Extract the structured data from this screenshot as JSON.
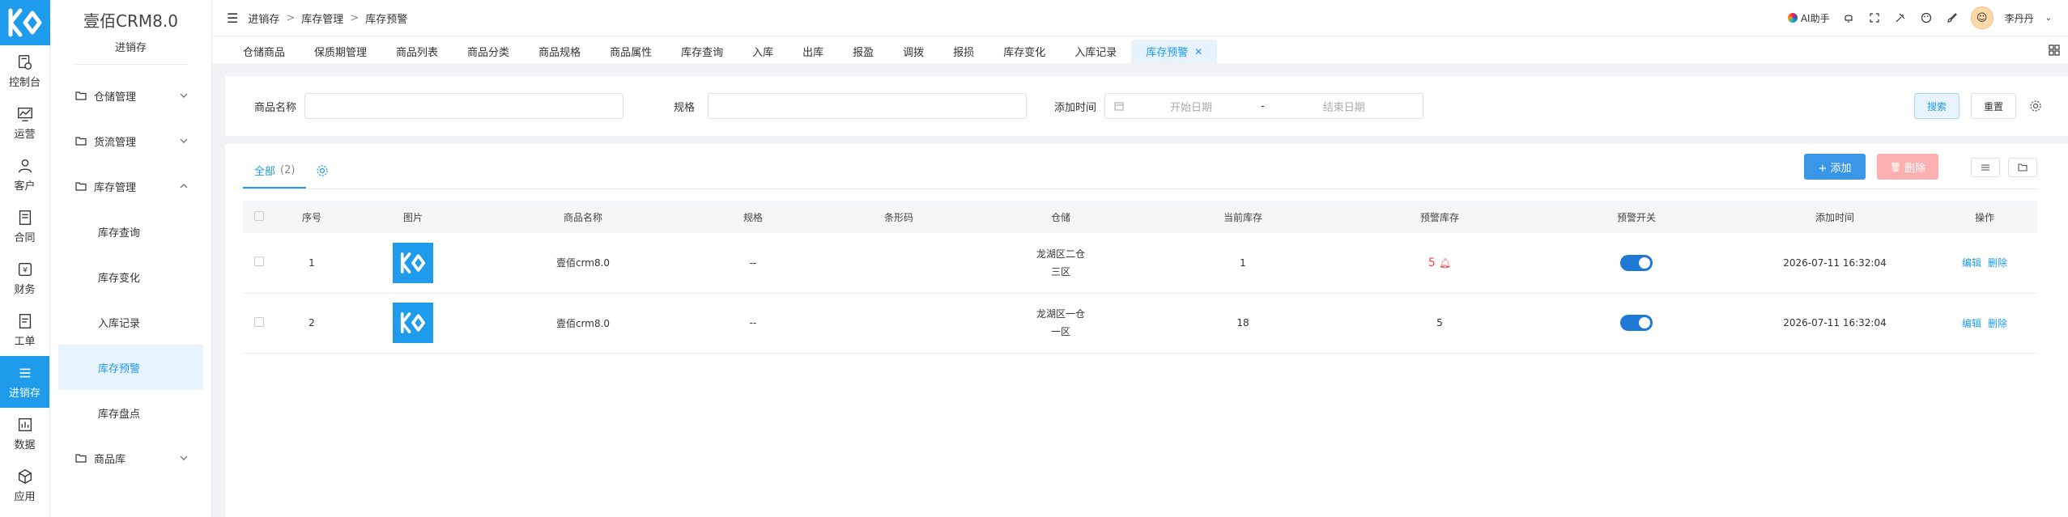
{
  "rail": {
    "items": [
      {
        "label": "控制台",
        "icon": "dashboard-icon"
      },
      {
        "label": "运营",
        "icon": "chart-icon"
      },
      {
        "label": "客户",
        "icon": "user-icon"
      },
      {
        "label": "合同",
        "icon": "document-icon"
      },
      {
        "label": "财务",
        "icon": "finance-icon"
      },
      {
        "label": "工单",
        "icon": "ticket-icon"
      },
      {
        "label": "进销存",
        "icon": "list-icon"
      },
      {
        "label": "数据",
        "icon": "bar-chart-icon"
      },
      {
        "label": "应用",
        "icon": "app-icon"
      }
    ]
  },
  "sidebar": {
    "brand": "壹佰CRM8.0",
    "module": "进销存",
    "groups": [
      {
        "label": "仓储管理"
      },
      {
        "label": "货流管理"
      },
      {
        "label": "库存管理"
      },
      {
        "label": "商品库"
      }
    ],
    "sub_items": [
      {
        "label": "库存查询"
      },
      {
        "label": "库存变化"
      },
      {
        "label": "入库记录"
      },
      {
        "label": "库存预警"
      },
      {
        "label": "库存盘点"
      }
    ]
  },
  "topbar": {
    "breadcrumb": [
      "进销存",
      "库存管理",
      "库存预警"
    ],
    "ai_label": "AI助手",
    "user_name": "李丹丹"
  },
  "tabs": [
    {
      "label": "仓储商品"
    },
    {
      "label": "保质期管理"
    },
    {
      "label": "商品列表"
    },
    {
      "label": "商品分类"
    },
    {
      "label": "商品规格"
    },
    {
      "label": "商品属性"
    },
    {
      "label": "库存查询"
    },
    {
      "label": "入库"
    },
    {
      "label": "出库"
    },
    {
      "label": "报盈"
    },
    {
      "label": "调拨"
    },
    {
      "label": "报损"
    },
    {
      "label": "库存变化"
    },
    {
      "label": "入库记录"
    },
    {
      "label": "库存预警"
    }
  ],
  "filter": {
    "name_label": "商品名称",
    "spec_label": "规格",
    "time_label": "添加时间",
    "start_placeholder": "开始日期",
    "range_sep": "-",
    "end_placeholder": "结束日期",
    "search_btn": "搜索",
    "reset_btn": "重置"
  },
  "list": {
    "tab_label": "全部",
    "tab_count": "(2)",
    "add_btn": "+ 添加",
    "delete_btn": "删除",
    "columns": [
      "序号",
      "图片",
      "商品名称",
      "规格",
      "条形码",
      "仓储",
      "当前库存",
      "预警库存",
      "预警开关",
      "添加时间",
      "操作"
    ],
    "rows": [
      {
        "index": "1",
        "name": "壹佰crm8.0",
        "spec": "--",
        "barcode": "",
        "warehouse_1": "龙湖区二仓",
        "warehouse_2": "三区",
        "stock": "1",
        "warn_stock": "5",
        "warn_highlight": true,
        "switch_on": true,
        "time": "2026-07-11 16:32:04",
        "edit": "编辑",
        "del": "删除"
      },
      {
        "index": "2",
        "name": "壹佰crm8.0",
        "spec": "--",
        "barcode": "",
        "warehouse_1": "龙湖区一仓",
        "warehouse_2": "一区",
        "stock": "18",
        "warn_stock": "5",
        "warn_highlight": false,
        "switch_on": true,
        "time": "2026-07-11 16:32:04",
        "edit": "编辑",
        "del": "删除"
      }
    ]
  },
  "colors": {
    "accent": "#1e9bea",
    "danger": "#f04848",
    "switch": "#1e78d6"
  }
}
